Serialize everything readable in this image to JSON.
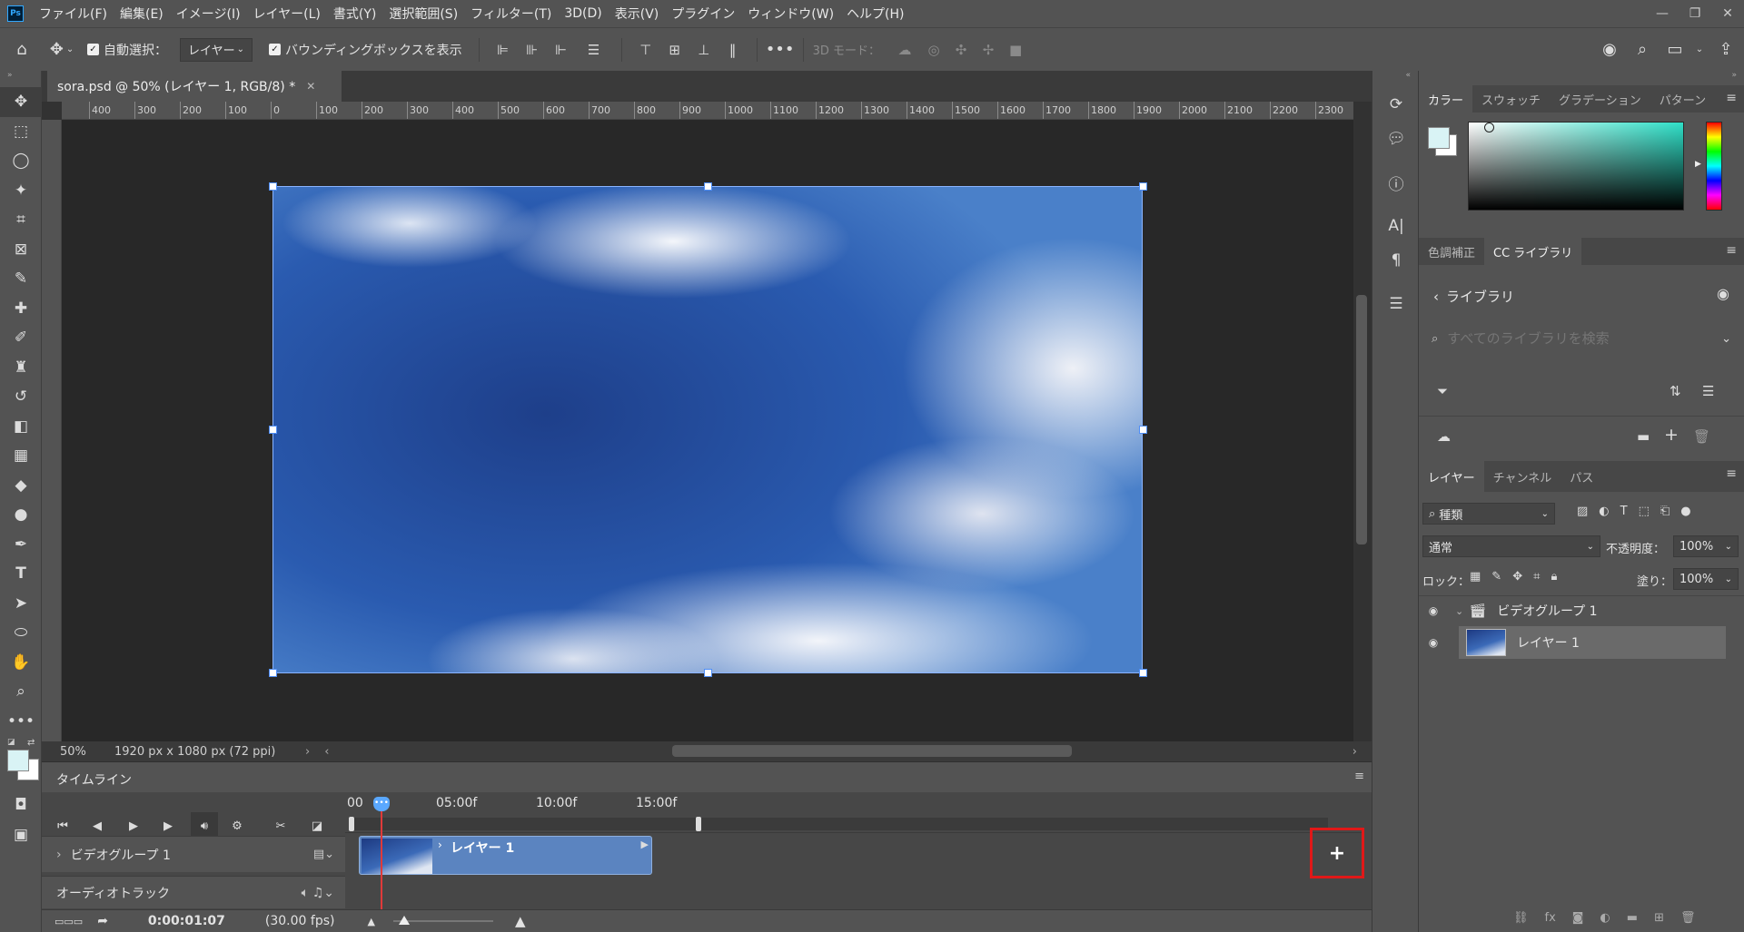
{
  "app": {
    "logo": "Ps"
  },
  "menu": [
    "ファイル(F)",
    "編集(E)",
    "イメージ(I)",
    "レイヤー(L)",
    "書式(Y)",
    "選択範囲(S)",
    "フィルター(T)",
    "3D(D)",
    "表示(V)",
    "プラグイン",
    "ウィンドウ(W)",
    "ヘルプ(H)"
  ],
  "window_controls": {
    "minimize": "—",
    "restore": "❐",
    "close": "✕"
  },
  "options": {
    "auto_select_label": "自動選択：",
    "auto_select_value": "レイヤー",
    "bounding_box_label": "バウンディングボックスを表示",
    "three_d_mode_label": "3D モード："
  },
  "document": {
    "tab_title": "sora.psd @ 50% (レイヤー 1, RGB/8) *",
    "ruler_ticks": [
      "400",
      "300",
      "200",
      "100",
      "0",
      "100",
      "200",
      "300",
      "400",
      "500",
      "600",
      "700",
      "800",
      "900",
      "1000",
      "1100",
      "1200",
      "1300",
      "1400",
      "1500",
      "1600",
      "1700",
      "1800",
      "1900",
      "2000",
      "2100",
      "2200",
      "2300"
    ],
    "zoom": "50%",
    "dimensions": "1920 px x 1080 px (72 ppi)"
  },
  "timeline": {
    "panel_title": "タイムライン",
    "ticks": [
      "00",
      "05:00f",
      "10:00f",
      "15:00f"
    ],
    "video_group_label": "ビデオグループ 1",
    "clip_label": "レイヤー 1",
    "audio_track_label": "オーディオトラック",
    "current_time": "0:00:01:07",
    "fps": "(30.00 fps)"
  },
  "panels": {
    "color_tabs": [
      "カラー",
      "スウォッチ",
      "グラデーション",
      "パターン"
    ],
    "library_tabs": [
      "色調補正",
      "CC ライブラリ"
    ],
    "library_title": "ライブラリ",
    "library_search_placeholder": "すべてのライブラリを検索",
    "layer_tabs": [
      "レイヤー",
      "チャンネル",
      "パス"
    ],
    "filter_kind": "種類",
    "blend_mode": "通常",
    "opacity_label": "不透明度：",
    "opacity_value": "100%",
    "lock_label": "ロック：",
    "fill_label": "塗り：",
    "fill_value": "100%",
    "layers": [
      {
        "name": "ビデオグループ 1"
      },
      {
        "name": "レイヤー 1"
      }
    ]
  },
  "colors": {
    "foreground": "#d9f3f5",
    "background": "#ffffff",
    "accent_red": "#e01818"
  }
}
